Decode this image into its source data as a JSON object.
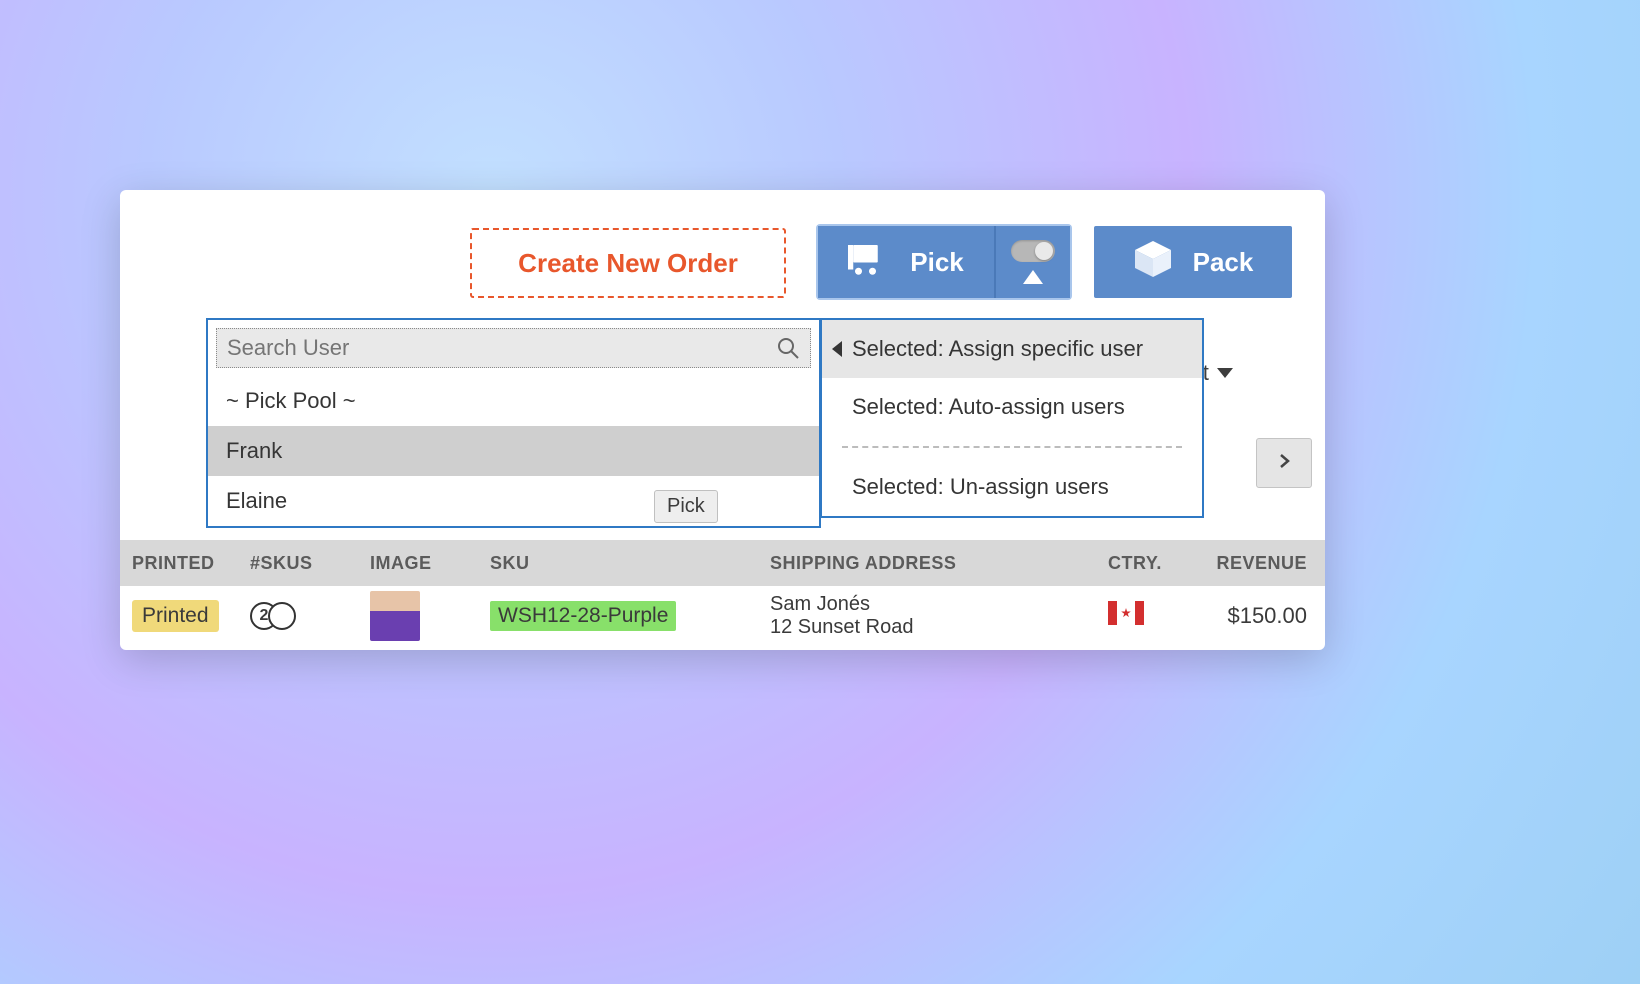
{
  "colors": {
    "accent_blue": "#5c8bca",
    "accent_orange": "#e8572c",
    "badge_yellow": "#f0d97a",
    "badge_green": "#88e06a",
    "border_blue": "#2f79c4"
  },
  "toolbar": {
    "create_order_label": "Create New Order",
    "pick_label": "Pick",
    "pick_toggle_on": false,
    "pack_label": "Pack",
    "export_label": "xport",
    "pick_cart_icon": "cart-icon",
    "pack_box_icon": "box-icon"
  },
  "user_popup": {
    "search_placeholder": "Search User",
    "options": [
      {
        "label": "~ Pick Pool ~",
        "selected": false
      },
      {
        "label": "Frank",
        "selected": true
      },
      {
        "label": "Elaine",
        "selected": false
      }
    ],
    "tooltip": "Pick"
  },
  "assign_popup": {
    "options": [
      {
        "label": "Selected: Assign specific user",
        "selected": true
      },
      {
        "label": "Selected: Auto-assign users",
        "selected": false
      }
    ],
    "post_sep_options": [
      {
        "label": "Selected: Un-assign users",
        "selected": false
      }
    ]
  },
  "table": {
    "headers": {
      "printed": "PRINTED",
      "skus": "#SKUS",
      "image": "IMAGE",
      "sku": "SKU",
      "shipping": "SHIPPING ADDRESS",
      "ctry": "CTRY.",
      "revenue": "REVENUE"
    },
    "rows": [
      {
        "printed_badge": "Printed",
        "sku_count": "2",
        "sku": "WSH12-28-Purple",
        "ship_name": "Sam Jonés",
        "ship_line2": "12 Sunset Road",
        "country_code": "CA",
        "revenue": "$150.00"
      }
    ]
  }
}
